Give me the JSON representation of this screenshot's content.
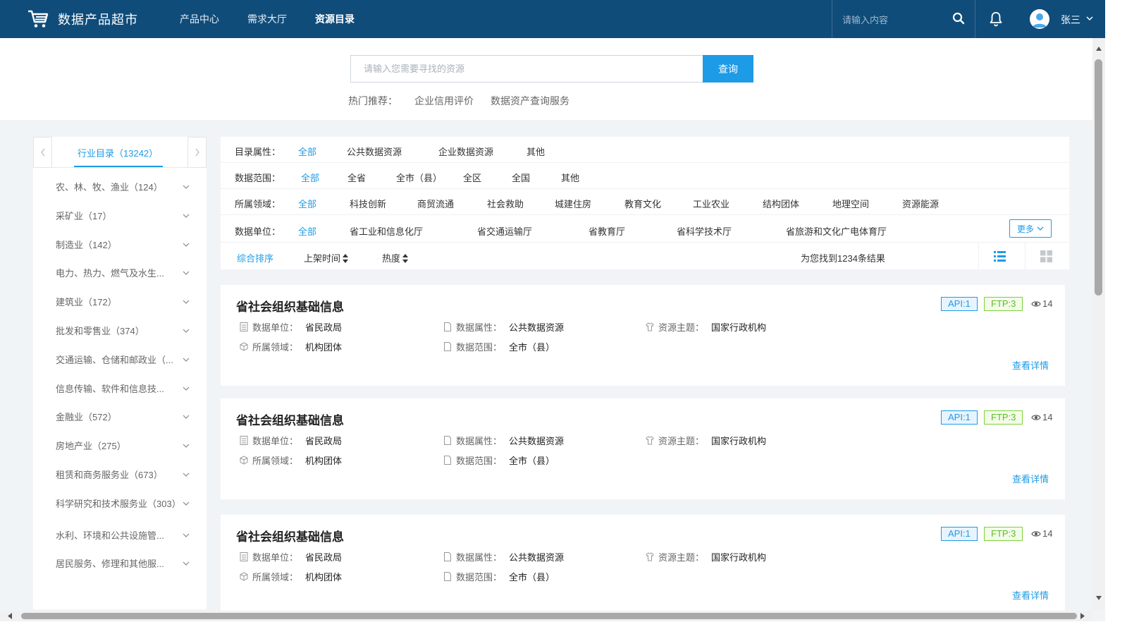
{
  "app": {
    "title": "数据产品超市"
  },
  "nav": [
    {
      "label": "产品中心",
      "active": false
    },
    {
      "label": "需求大厅",
      "active": false
    },
    {
      "label": "资源目录",
      "active": true
    }
  ],
  "top_search": {
    "placeholder": "请输入内容"
  },
  "user": {
    "name": "张三"
  },
  "hero": {
    "placeholder": "请输入您需要寻找的资源",
    "button": "查询",
    "hot_label": "热门推荐：",
    "hot_items": [
      "企业信用评价",
      "数据资产查询服务"
    ]
  },
  "sidebar": {
    "tab": "行业目录（13242）",
    "items": [
      "农、林、牧、渔业（124）",
      "采矿业（17）",
      "制造业（142）",
      "电力、热力、燃气及水生...",
      "建筑业（172）",
      "批发和零售业（374）",
      "交通运输、仓储和邮政业（...",
      "信息传输、软件和信息技...",
      "金融业（572）",
      "房地产业（275）",
      "租赁和商务服务业（673）",
      "科学研究和技术服务业（303）",
      "水利、环境和公共设施管...",
      "居民服务、修理和其他服..."
    ]
  },
  "filters": [
    {
      "label": "目录属性：",
      "options": [
        "全部",
        "公共数据资源",
        "企业数据资源",
        "其他"
      ]
    },
    {
      "label": "数据范围：",
      "options": [
        "全部",
        "全省",
        "全市（县）",
        "全区",
        "全国",
        "其他"
      ]
    },
    {
      "label": "所属领域：",
      "options": [
        "全部",
        "科技创新",
        "商贸流通",
        "社会救助",
        "城建住房",
        "教育文化",
        "工业农业",
        "结构团体",
        "地理空间",
        "资源能源"
      ]
    },
    {
      "label": "数据单位：",
      "options": [
        "全部",
        "省工业和信息化厅",
        "省交通运输厅",
        "省教育厅",
        "省科学技术厅",
        "省旅游和文化广电体育厅"
      ]
    }
  ],
  "more_label": "更多",
  "sort": {
    "options": [
      "综合排序",
      "上架时间",
      "热度"
    ],
    "result_text": "为您找到1234条结果"
  },
  "results": [
    {
      "title": "省社会组织基础信息",
      "unit_label": "数据单位：",
      "unit": "省民政局",
      "attr_label": "数据属性：",
      "attr": "公共数据资源",
      "theme_label": "资源主题：",
      "theme": "国家行政机构",
      "domain_label": "所属领域：",
      "domain": "机构团体",
      "scope_label": "数据范围：",
      "scope": "全市（县）",
      "api": "API:1",
      "ftp": "FTP:3",
      "views": "14",
      "detail": "查看详情"
    },
    {
      "title": "省社会组织基础信息",
      "unit_label": "数据单位：",
      "unit": "省民政局",
      "attr_label": "数据属性：",
      "attr": "公共数据资源",
      "theme_label": "资源主题：",
      "theme": "国家行政机构",
      "domain_label": "所属领域：",
      "domain": "机构团体",
      "scope_label": "数据范围：",
      "scope": "全市（县）",
      "api": "API:1",
      "ftp": "FTP:3",
      "views": "14",
      "detail": "查看详情"
    },
    {
      "title": "省社会组织基础信息",
      "unit_label": "数据单位：",
      "unit": "省民政局",
      "attr_label": "数据属性：",
      "attr": "公共数据资源",
      "theme_label": "资源主题：",
      "theme": "国家行政机构",
      "domain_label": "所属领域：",
      "domain": "机构团体",
      "scope_label": "数据范围：",
      "scope": "全市（县）",
      "api": "API:1",
      "ftp": "FTP:3",
      "views": "14",
      "detail": "查看详情"
    }
  ],
  "colors": {
    "header": "#0f4c7a",
    "accent": "#1e9be6",
    "ftp": "#5bbf20"
  },
  "icons": [
    "cart-icon",
    "search-icon",
    "bell-icon",
    "avatar",
    "chevron-down-icon",
    "list-view-icon",
    "grid-view-icon",
    "eye-icon",
    "document-icon",
    "box-icon",
    "shirt-icon"
  ]
}
